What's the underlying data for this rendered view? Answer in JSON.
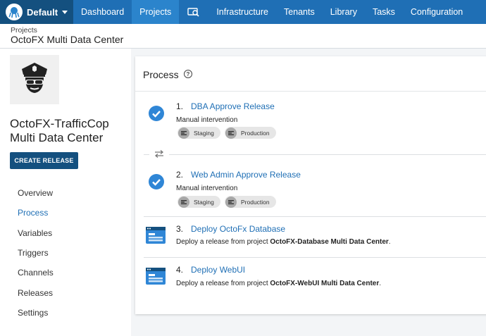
{
  "topnav": {
    "space_label": "Default",
    "items": [
      {
        "label": "Dashboard"
      },
      {
        "label": "Projects"
      },
      {
        "label": "Infrastructure"
      },
      {
        "label": "Tenants"
      },
      {
        "label": "Library"
      },
      {
        "label": "Tasks"
      },
      {
        "label": "Configuration"
      }
    ],
    "active": "Projects",
    "colors": {
      "nav": "#1f6fb5",
      "space": "#14507f",
      "active": "#2b84cc"
    }
  },
  "breadcrumb": {
    "parent": "Projects",
    "title": "OctoFX Multi Data Center"
  },
  "sidebar": {
    "project_name": "OctoFX-TrafficCop Multi Data Center",
    "create_release_label": "CREATE RELEASE",
    "nav": [
      {
        "label": "Overview"
      },
      {
        "label": "Process"
      },
      {
        "label": "Variables"
      },
      {
        "label": "Triggers"
      },
      {
        "label": "Channels"
      },
      {
        "label": "Releases"
      },
      {
        "label": "Settings"
      }
    ],
    "active": "Process"
  },
  "process": {
    "title": "Process",
    "steps": [
      {
        "number": "1.",
        "title": "DBA Approve Release",
        "description": "Manual intervention",
        "environments": [
          "Staging",
          "Production"
        ],
        "icon": "check-circle-icon"
      },
      {
        "number": "2.",
        "title": "Web Admin Approve Release",
        "description": "Manual intervention",
        "environments": [
          "Staging",
          "Production"
        ],
        "icon": "check-circle-icon"
      },
      {
        "number": "3.",
        "title": "Deploy OctoFx Database",
        "description_prefix": "Deploy a release from project ",
        "description_project": "OctoFX-Database Multi Data Center",
        "description_suffix": ".",
        "icon": "deploy-release-icon"
      },
      {
        "number": "4.",
        "title": "Deploy WebUI",
        "description_prefix": "Deploy a release from project ",
        "description_project": "OctoFX-WebUI Multi Data Center",
        "description_suffix": ".",
        "icon": "deploy-release-icon"
      }
    ]
  },
  "colors": {
    "accent": "#1f6fb5",
    "dark": "#14507f",
    "check": "#2f86d6"
  }
}
